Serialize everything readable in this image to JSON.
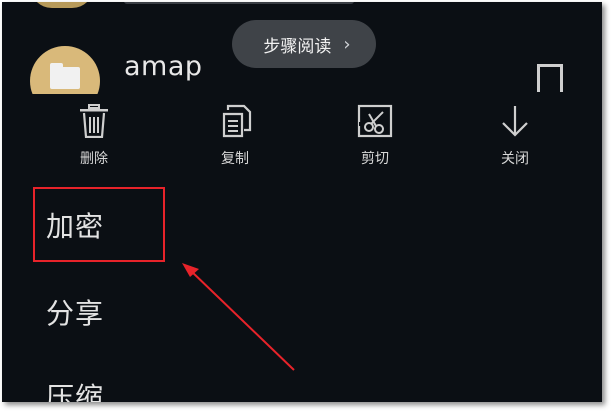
{
  "toast": {
    "label": "步骤阅读",
    "chevron": "›"
  },
  "folder": {
    "name": "amap",
    "icon": "folder-icon",
    "icon_bg": "#d9b97a"
  },
  "actions": [
    {
      "label": "删除",
      "icon": "trash-icon"
    },
    {
      "label": "复制",
      "icon": "copy-icon"
    },
    {
      "label": "剪切",
      "icon": "scissors-icon"
    },
    {
      "label": "关闭",
      "icon": "arrow-down-icon"
    }
  ],
  "menu": [
    {
      "label": "加密"
    },
    {
      "label": "分享"
    },
    {
      "label": "压缩"
    }
  ],
  "colors": {
    "background": "#0b0f14",
    "annotation": "#e8232a",
    "toast_bg": "#3f4348"
  }
}
